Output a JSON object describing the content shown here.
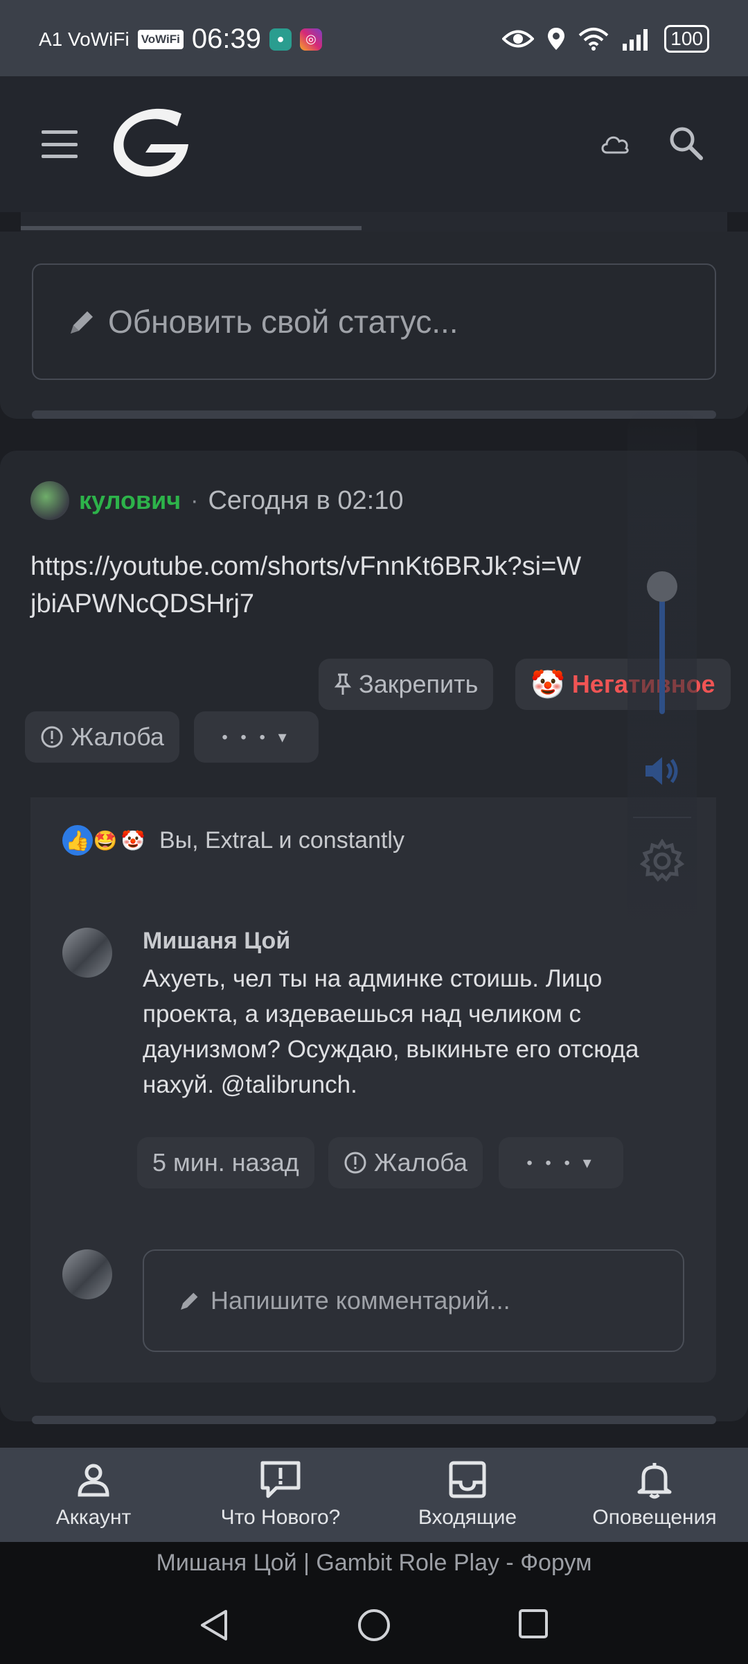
{
  "status_bar": {
    "carrier": "A1 VoWiFi",
    "vowifi_badge": "VoWiFi",
    "time": "06:39",
    "battery": "100"
  },
  "status_composer": {
    "placeholder": "Обновить свой статус..."
  },
  "post": {
    "author": "кулович",
    "separator": "·",
    "timestamp": "Сегодня в 02:10",
    "body": "https://youtube.com/shorts/vFnnKt6BRJk?si=WjbiAPWNcQDSHrj7",
    "pin_label": "Закрепить",
    "reaction_label": "Негативное",
    "report_label": "Жалоба",
    "more_label": "• • • ▾",
    "reactions_summary": "Вы, ExtraL и constantly"
  },
  "comment": {
    "author": "Мишаня Цой",
    "text": "Ахуеть, чел ты на админке стоишь. Лицо проекта, а издеваешься над челиком с даунизмом? Осуждаю, выкиньте его отсюда нахуй. @talibrunch.",
    "time": "5 мин. назад",
    "report_label": "Жалоба",
    "more_label": "• • • ▾",
    "input_placeholder": "Напишите комментарий..."
  },
  "bottom_nav": {
    "account": "Аккаунт",
    "whats_new": "Что Нового?",
    "inbox": "Входящие",
    "alerts": "Оповещения"
  },
  "page_title": "Мишаня Цой | Gambit Role Play - Форум",
  "colors": {
    "author_green": "#2db34a",
    "negative_red": "#f05454",
    "volume_blue": "#2e4f86"
  }
}
